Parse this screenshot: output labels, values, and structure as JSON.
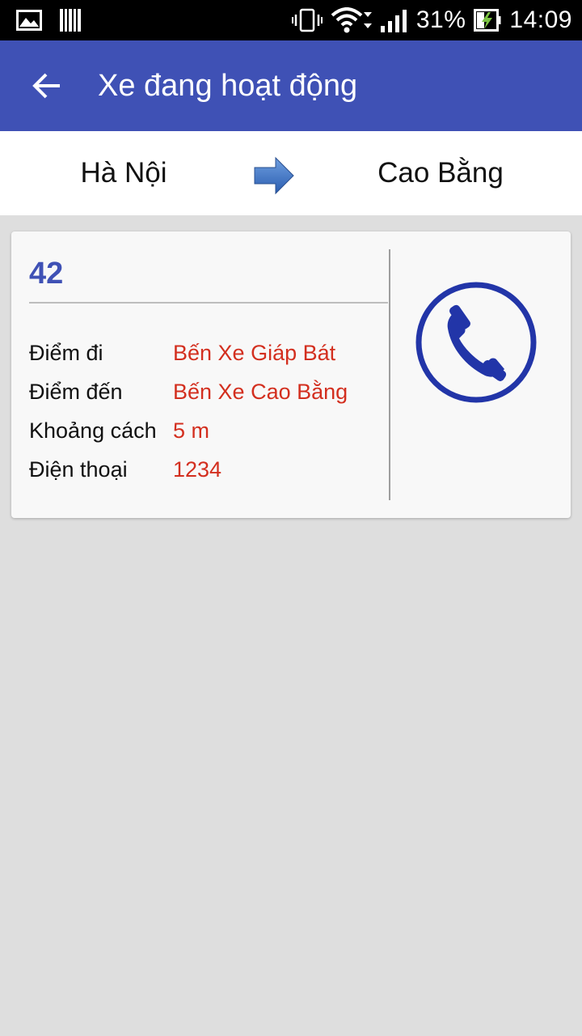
{
  "status_bar": {
    "battery_percent": "31%",
    "time": "14:09"
  },
  "app_bar": {
    "title": "Xe đang hoạt động"
  },
  "route": {
    "from": "Hà Nội",
    "to": "Cao Bằng"
  },
  "vehicle": {
    "id": "42",
    "details": [
      {
        "label": "Điểm đi",
        "value": "Bến Xe Giáp Bát"
      },
      {
        "label": "Điểm đến",
        "value": "Bến Xe Cao Bằng"
      },
      {
        "label": "Khoảng cách",
        "value": "5 m"
      },
      {
        "label": "Điện thoại",
        "value": "1234"
      }
    ]
  },
  "colors": {
    "primary": "#3f51b5",
    "value_text": "#d32f1f",
    "call_icon": "#2235a8"
  }
}
